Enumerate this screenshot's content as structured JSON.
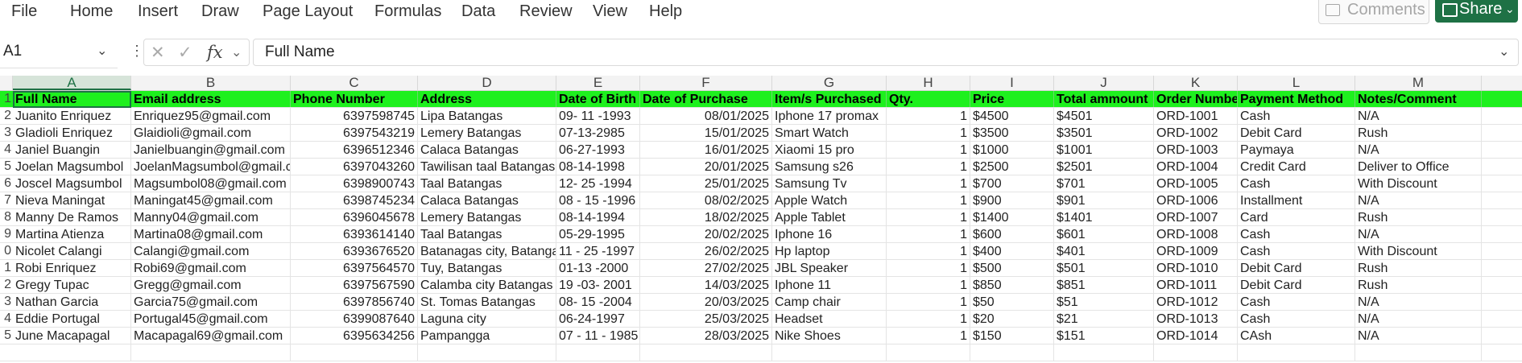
{
  "menu": [
    "File",
    "Home",
    "Insert",
    "Draw",
    "Page Layout",
    "Formulas",
    "Data",
    "Review",
    "View",
    "Help"
  ],
  "toolbar": {
    "comments_label": "Comments",
    "share_label": "Share"
  },
  "formula_bar": {
    "name_box": "A1",
    "fx": "fx",
    "value": "Full Name"
  },
  "columns": [
    "A",
    "B",
    "C",
    "D",
    "E",
    "F",
    "G",
    "H",
    "I",
    "J",
    "K",
    "L",
    "M"
  ],
  "row_numbers": [
    "1",
    "2",
    "3",
    "4",
    "5",
    "6",
    "7",
    "8",
    "9",
    "0",
    "1",
    "2",
    "3",
    "4",
    "5"
  ],
  "headers": [
    "Full Name",
    "Email address",
    "Phone Number",
    "Address",
    "Date of Birth",
    "Date of Purchase",
    "Item/s Purchased",
    "Qty.",
    "Price",
    "Total ammount",
    "Order  Numbe",
    "Payment Method",
    "Notes/Comment"
  ],
  "rows": [
    [
      "Juanito Enriquez",
      "Enriquez95@gmail.com",
      "6397598745",
      "Lipa Batangas",
      "09- 11 -1993",
      "08/01/2025",
      "Iphone 17 promax",
      "1",
      "$4500",
      "$4501",
      "ORD-1001",
      "Cash",
      "N/A"
    ],
    [
      "Gladioli Enriquez",
      "Glaidioli@gmail.com",
      "6397543219",
      "Lemery Batangas",
      "07-13-2985",
      "15/01/2025",
      "Smart  Watch",
      "1",
      "$3500",
      "$3501",
      "ORD-1002",
      "Debit Card",
      "Rush"
    ],
    [
      "Janiel Buangin",
      "Janielbuangin@gmail.com",
      "6396512346",
      "Calaca Batangas",
      "06-27-1993",
      "16/01/2025",
      "Xiaomi 15 pro",
      "1",
      "$1000",
      "$1001",
      "ORD-1003",
      "Paymaya",
      "N/A"
    ],
    [
      "Joelan Magsumbol",
      "JoelanMagsumbol@gmail.c",
      "6397043260",
      "Tawilisan taal Batangas",
      "08-14-1998",
      "20/01/2025",
      "Samsung s26",
      "1",
      "$2500",
      "$2501",
      "ORD-1004",
      "Credit Card",
      "Deliver to Office"
    ],
    [
      "Joscel Magsumbol",
      "Magsumbol08@gmail.com",
      "6398900743",
      "Taal Batangas",
      "12- 25 -1994",
      "25/01/2025",
      "Samsung Tv",
      "1",
      "$700",
      "$701",
      "ORD-1005",
      "Cash",
      "With Discount"
    ],
    [
      "Nieva Maningat",
      "Maningat45@gmail.com",
      "6398745234",
      "Calaca Batangas",
      "08 - 15 -1996",
      "08/02/2025",
      "Apple Watch",
      "1",
      "$900",
      "$901",
      "ORD-1006",
      "Installment",
      "N/A"
    ],
    [
      "Manny De Ramos",
      "Manny04@gmail.com",
      "6396045678",
      "Lemery Batangas",
      "08-14-1994",
      "18/02/2025",
      "Apple Tablet",
      "1",
      "$1400",
      "$1401",
      "ORD-1007",
      "Card",
      "Rush"
    ],
    [
      "Martina Atienza",
      "Martina08@gmail.com",
      "6393614140",
      "Taal Batangas",
      "05-29-1995",
      "20/02/2025",
      "Iphone 16",
      "1",
      "$600",
      "$601",
      "ORD-1008",
      "Cash",
      "N/A"
    ],
    [
      "Nicolet Calangi",
      "Calangi@gmail.com",
      "6393676520",
      "Batanagas city, Batangas",
      "11 - 25 -1997",
      "26/02/2025",
      "Hp laptop",
      "1",
      "$400",
      "$401",
      "ORD-1009",
      "Cash",
      "With Discount"
    ],
    [
      "Robi Enriquez",
      "Robi69@gmail.com",
      "6397564570",
      "Tuy, Batangas",
      "01-13 -2000",
      "27/02/2025",
      "JBL Speaker",
      "1",
      "$500",
      "$501",
      "ORD-1010",
      "Debit Card",
      "Rush"
    ],
    [
      "Gregy Tupac",
      "Gregg@gmail.com",
      "6397567590",
      "Calamba city Batangas",
      "19 -03- 2001",
      "14/03/2025",
      "Iphone 11",
      "1",
      "$850",
      "$851",
      "ORD-1011",
      "Debit Card",
      "Rush"
    ],
    [
      "Nathan Garcia",
      "Garcia75@gmail.com",
      "6397856740",
      "St. Tomas Batangas",
      "08- 15 -2004",
      "20/03/2025",
      "Camp chair",
      "1",
      "$50",
      "$51",
      "ORD-1012",
      "Cash",
      "N/A"
    ],
    [
      "Eddie Portugal",
      "Portugal45@gmail.com",
      "6399087640",
      "Laguna city",
      "06-24-1997",
      "25/03/2025",
      "Headset",
      "1",
      "$20",
      "$21",
      "ORD-1013",
      "Cash",
      "N/A"
    ],
    [
      "June Macapagal",
      "Macapagal69@gmail.com",
      "6395634256",
      "Pampangga",
      "07 - 11 - 1985",
      "28/03/2025",
      "Nike Shoes",
      "1",
      "$150",
      "$151",
      "ORD-1014",
      "CAsh",
      "N/A"
    ]
  ]
}
